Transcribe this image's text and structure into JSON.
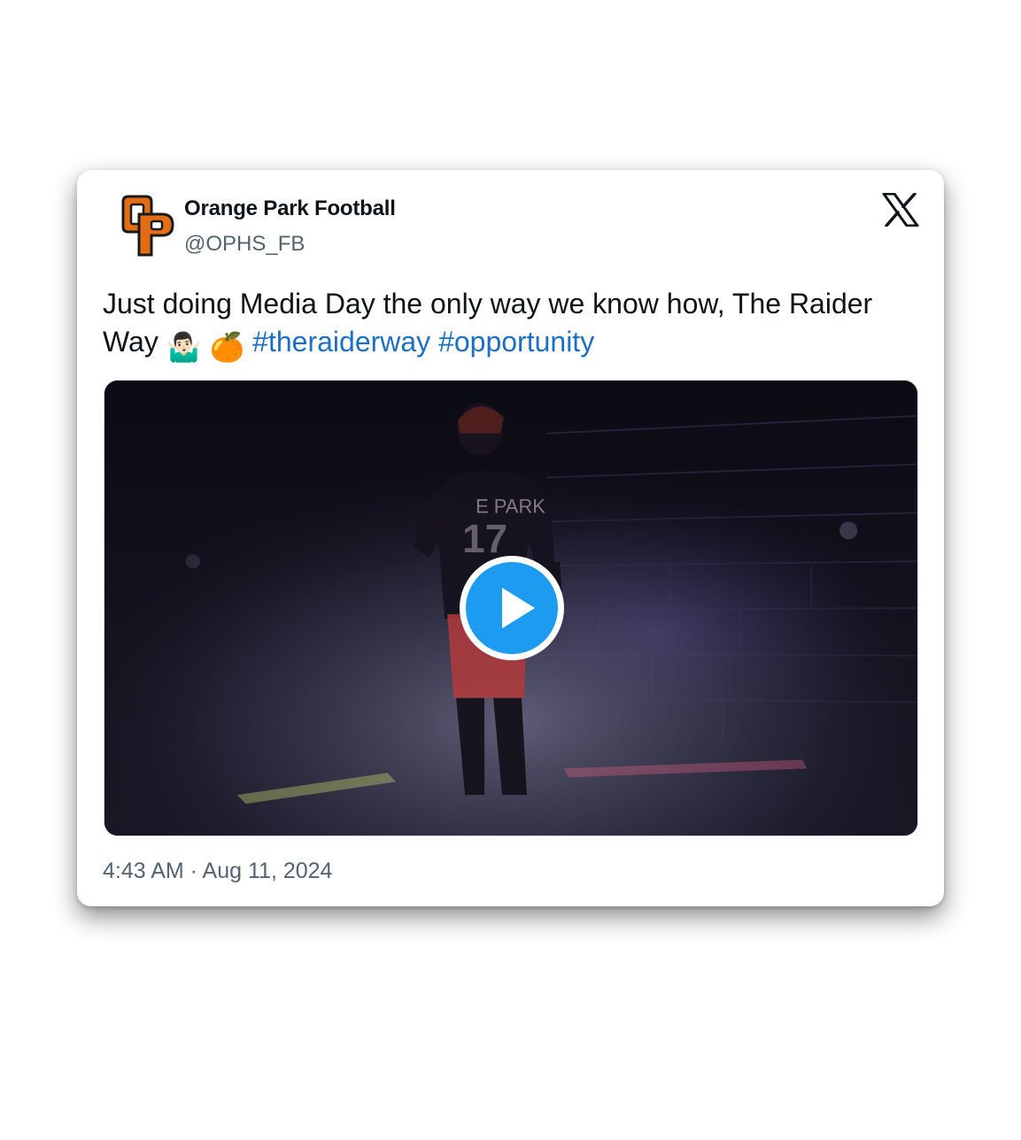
{
  "tweet": {
    "author_name": "Orange Park Football",
    "author_handle": "@OPHS_FB",
    "text_main": "Just doing Media Day the only way we know how, The Raider Way",
    "emoji_1": "🤷🏻‍♂️",
    "emoji_2": "🍊",
    "hashtags": [
      "#theraiderway",
      "#opportunity"
    ],
    "timestamp": "4:43 AM · Aug 11, 2024"
  },
  "icons": {
    "avatar": "op-logo-icon",
    "platform": "x-logo-icon",
    "play": "play-icon"
  },
  "colors": {
    "hashtag": "#1d6fc4",
    "play_button": "#1d9bf0",
    "logo_orange": "#e36d14",
    "text": "#0f1419",
    "muted": "#536471"
  }
}
